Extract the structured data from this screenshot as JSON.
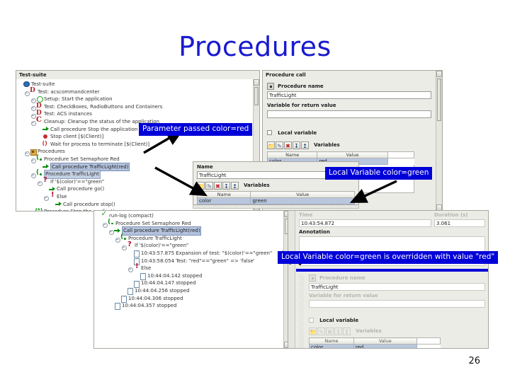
{
  "slide": {
    "title": "Procedures",
    "page_number": "26"
  },
  "test_suite_panel": {
    "title": "Test-suite",
    "nodes": [
      {
        "label": "Test-suite",
        "icon": "globe-icon",
        "indent": 0,
        "toggle": false,
        "state": "normal"
      },
      {
        "label": "Test: acscommandcenter",
        "icon": "flask-icon",
        "indent": 1,
        "toggle": true,
        "state": "normal"
      },
      {
        "label": "Setup: Start the application",
        "icon": "ring-icon",
        "indent": 2,
        "toggle": true,
        "state": "normal"
      },
      {
        "label": "Test: CheckBoxes, RadioButtons and Containers",
        "icon": "flask-icon",
        "indent": 2,
        "toggle": true,
        "state": "normal"
      },
      {
        "label": "Test: ACS instances",
        "icon": "flask-icon",
        "indent": 2,
        "toggle": true,
        "state": "normal"
      },
      {
        "label": "Cleanup: Cleanup the status of the application",
        "icon": "curve-icon",
        "indent": 2,
        "toggle": true,
        "state": "normal"
      },
      {
        "label": "Call procedure Stop the application",
        "icon": "call-arrow-icon",
        "indent": 3,
        "toggle": false,
        "state": "normal"
      },
      {
        "label": "Stop client [$(Client)]",
        "icon": "stop-dot-icon",
        "indent": 3,
        "toggle": false,
        "state": "normal"
      },
      {
        "label": "Wait for process to terminate [$(Client)]",
        "icon": "wait-icon",
        "indent": 3,
        "toggle": false,
        "state": "normal"
      },
      {
        "label": "Procedures",
        "icon": "folder-icon",
        "indent": 1,
        "toggle": true,
        "state": "normal"
      },
      {
        "label": "Procedure Set Semaphore Red",
        "icon": "procedure-icon",
        "indent": 2,
        "toggle": true,
        "state": "normal"
      },
      {
        "label": "Call procedure TrafficLight(red)",
        "icon": "call-arrow-icon",
        "indent": 3,
        "toggle": false,
        "state": "selected"
      },
      {
        "label": "Procedure TrafficLight",
        "icon": "procedure-icon",
        "indent": 2,
        "toggle": true,
        "state": "selected2"
      },
      {
        "label": "If '$(color)'==\"green\"",
        "icon": "question-icon",
        "indent": 3,
        "toggle": true,
        "state": "normal"
      },
      {
        "label": "Call procedure go()",
        "icon": "call-arrow-icon",
        "indent": 4,
        "toggle": false,
        "state": "normal"
      },
      {
        "label": "Else",
        "icon": "bang-icon",
        "indent": 4,
        "toggle": true,
        "state": "normal"
      },
      {
        "label": "Call procedure stop()",
        "icon": "call-arrow-icon",
        "indent": 5,
        "toggle": false,
        "state": "normal"
      },
      {
        "label": "Procedure Stop the application",
        "icon": "procedure-star-icon",
        "indent": 2,
        "toggle": true,
        "state": "normal"
      }
    ]
  },
  "procedure_call_panel": {
    "title": "Procedure call",
    "procedure_name_label": "Procedure name",
    "procedure_name_value": "TrafficLight",
    "return_variable_label": "Variable for return value",
    "return_variable_value": "",
    "local_variable_label": "Local variable",
    "local_variable_checked": false,
    "variables_label": "Variables",
    "toolbar_icons": [
      "open-folder-icon",
      "edit-icon",
      "delete-icon",
      "move-down-icon",
      "move-up-icon"
    ],
    "table": {
      "headers": [
        "Name",
        "Value"
      ],
      "rows": [
        [
          "color",
          "red"
        ]
      ]
    }
  },
  "name_panel": {
    "title": "Name",
    "name_value": "TrafficLight",
    "variables_label": "Variables",
    "toolbar_icons": [
      "open-folder-icon",
      "edit-icon",
      "delete-icon",
      "move-down-icon",
      "move-up-icon"
    ],
    "table": {
      "headers": [
        "Name",
        "Value"
      ],
      "rows": [
        [
          "color",
          "green"
        ]
      ]
    }
  },
  "runlog_panel": {
    "nodes": [
      {
        "label": "run-log (compact)",
        "icon": "check-icon",
        "indent": 0,
        "toggle": false,
        "state": "normal"
      },
      {
        "label": "Procedure Set Semaphore Red",
        "icon": "procedure-icon",
        "indent": 1,
        "toggle": true,
        "state": "normal"
      },
      {
        "label": "Call procedure TrafficLight(red)",
        "icon": "call-arrow-icon",
        "indent": 2,
        "toggle": true,
        "state": "selected"
      },
      {
        "label": "Procedure TrafficLight",
        "icon": "procedure-icon",
        "indent": 3,
        "toggle": true,
        "state": "normal"
      },
      {
        "label": "If '$(color)'==\"green\"",
        "icon": "question-icon",
        "indent": 4,
        "toggle": true,
        "state": "normal"
      },
      {
        "label": "10:43:57.875 Expansion of test: \"$(color)'==\"green\"",
        "icon": "doc-icon",
        "indent": 5,
        "toggle": false,
        "state": "normal"
      },
      {
        "label": "10:43:58.054 Test: \"red\"==\"green\" => 'false'",
        "icon": "doc-icon",
        "indent": 5,
        "toggle": false,
        "state": "normal"
      },
      {
        "label": "Else",
        "icon": "bang-icon",
        "indent": 5,
        "toggle": true,
        "state": "normal"
      },
      {
        "label": "10:44:04.142 stopped",
        "icon": "doc-icon",
        "indent": 6,
        "toggle": false,
        "state": "normal"
      },
      {
        "label": "10:44:04.147 stopped",
        "icon": "doc-icon",
        "indent": 5,
        "toggle": false,
        "state": "normal"
      },
      {
        "label": "10:44:04.256 stopped",
        "icon": "doc-icon",
        "indent": 4,
        "toggle": false,
        "state": "normal"
      },
      {
        "label": "10:44:04.306 stopped",
        "icon": "doc-icon",
        "indent": 3,
        "toggle": false,
        "state": "normal"
      },
      {
        "label": "10:44:04.357 stopped",
        "icon": "doc-icon",
        "indent": 2,
        "toggle": false,
        "state": "normal"
      }
    ]
  },
  "detail_panel": {
    "time_label": "Time",
    "time_value": "10:43:54.872",
    "duration_label": "Duration (s)",
    "duration_value": "3.061",
    "annotation_label": "Annotation",
    "annotation_value": ""
  },
  "detail_procedure_panel": {
    "procedure_name_label": "Procedure name",
    "procedure_name_value": "TrafficLight",
    "return_variable_label": "Variable for return value",
    "return_variable_value": "",
    "local_variable_label": "Local variable",
    "local_variable_checked": false,
    "variables_label": "Variables",
    "table": {
      "headers": [
        "Name",
        "Value"
      ],
      "rows": [
        [
          "color",
          "red"
        ]
      ]
    }
  },
  "callouts": [
    {
      "text": "Parameter passed color=red"
    },
    {
      "text": "Local Variable color=green"
    },
    {
      "text": "Local Variable color=green is overridden with value \"red\""
    }
  ],
  "colors": {
    "title": "#1a1ad0",
    "callout_bg": "#0000d8",
    "callout_text": "#ffffff",
    "selection": "#b4c3dd"
  }
}
